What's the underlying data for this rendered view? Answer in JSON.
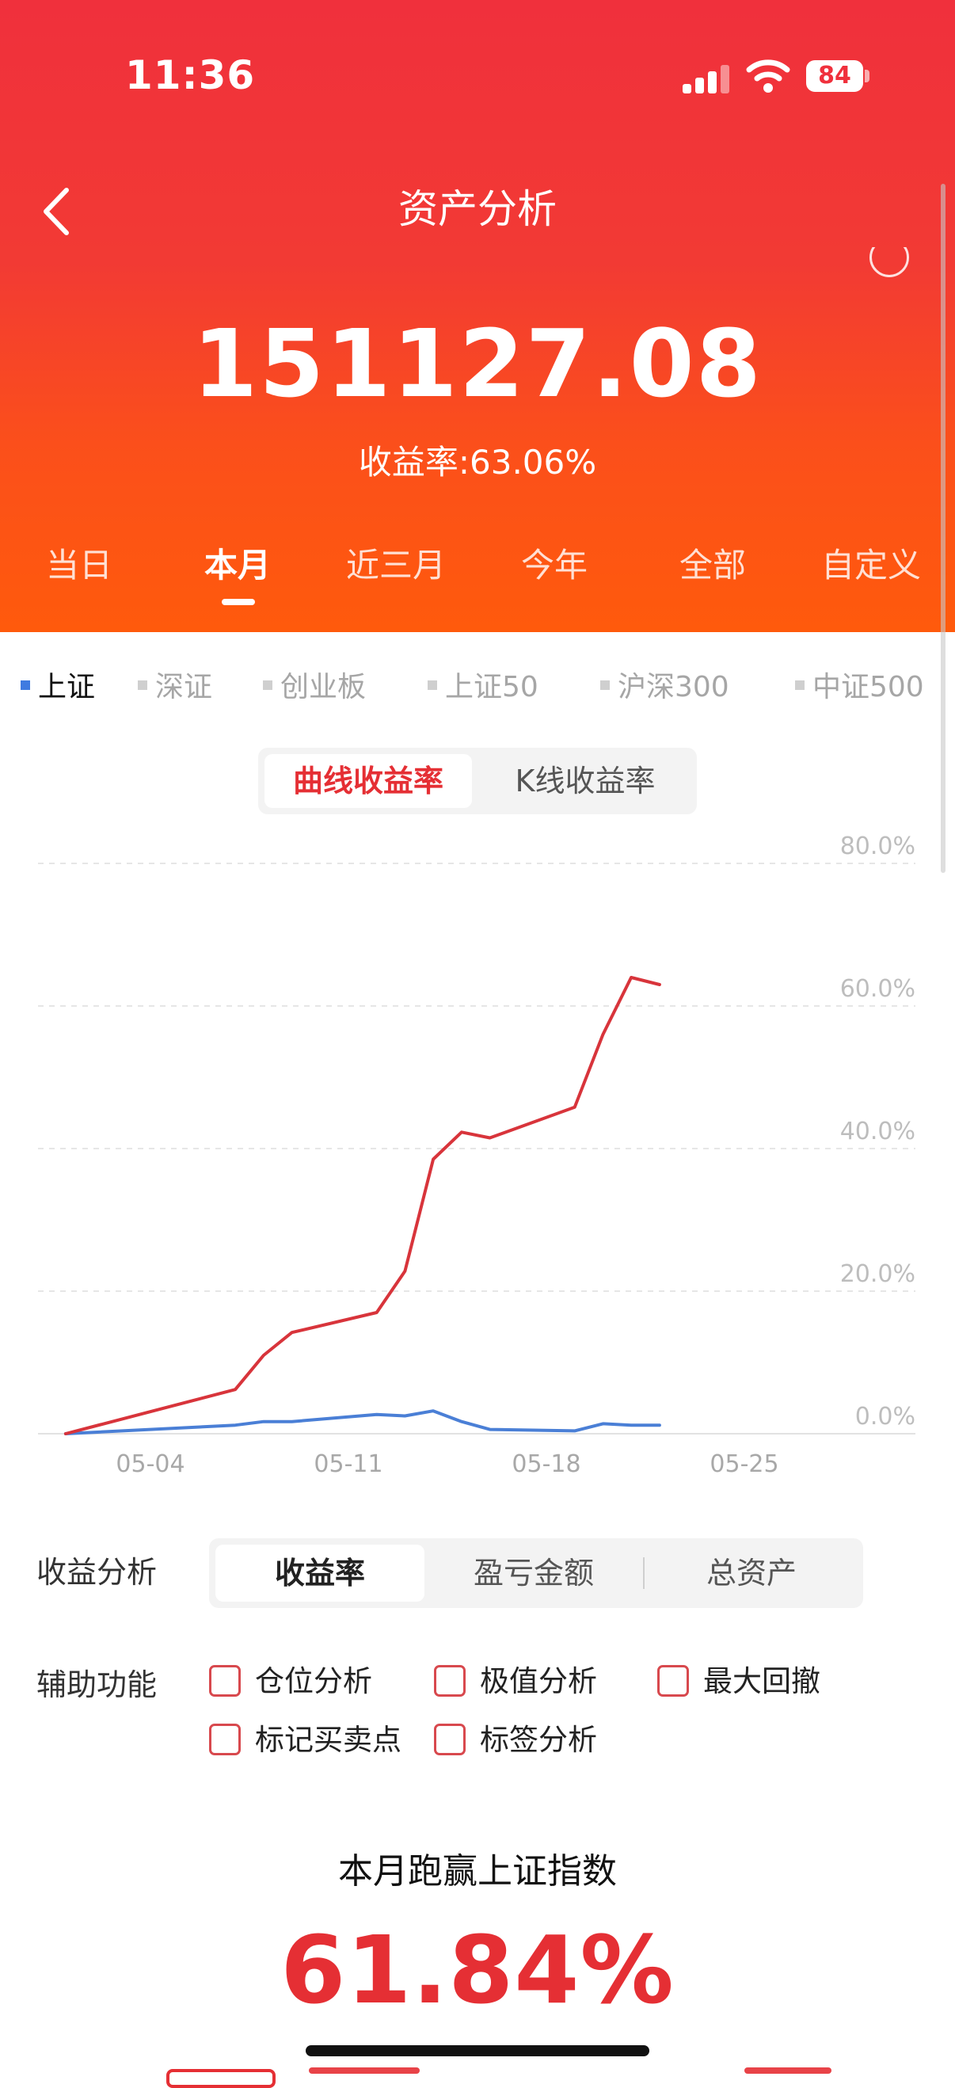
{
  "status_bar": {
    "time": "11:36",
    "battery": "84"
  },
  "nav": {
    "title": "资产分析"
  },
  "summary": {
    "total_assets": "151127.08",
    "return_rate": "收益率:63.06%"
  },
  "period_tabs": [
    {
      "label": "当日",
      "active": false
    },
    {
      "label": "本月",
      "active": true
    },
    {
      "label": "近三月",
      "active": false
    },
    {
      "label": "今年",
      "active": false
    },
    {
      "label": "全部",
      "active": false
    },
    {
      "label": "自定义",
      "active": false
    }
  ],
  "index_tabs": [
    {
      "label": "上证",
      "active": true
    },
    {
      "label": "深证",
      "active": false
    },
    {
      "label": "创业板",
      "active": false
    },
    {
      "label": "上证50",
      "active": false
    },
    {
      "label": "沪深300",
      "active": false
    },
    {
      "label": "中证500",
      "active": false
    }
  ],
  "chart_mode": {
    "options": [
      "曲线收益率",
      "K线收益率"
    ],
    "selected": "曲线收益率"
  },
  "chart_data": {
    "type": "line",
    "ylim": [
      0,
      80
    ],
    "y_ticks": [
      "80.0%",
      "60.0%",
      "40.0%",
      "20.0%",
      "0.0%"
    ],
    "x_ticks": [
      "05-04",
      "05-11",
      "05-18",
      "05-25"
    ],
    "grid": true,
    "colors": {
      "portfolio": "#d8343b",
      "index": "#4a7fd6"
    },
    "series": [
      {
        "key": "portfolio",
        "x": [
          "05-01",
          "05-07",
          "05-08",
          "05-09",
          "05-12",
          "05-13",
          "05-14",
          "05-15",
          "05-16",
          "05-19",
          "05-20",
          "05-21",
          "05-22"
        ],
        "values": [
          0,
          6.2,
          11,
          14.2,
          17,
          22.8,
          38.5,
          42.3,
          41.5,
          45.8,
          56,
          64,
          63
        ]
      },
      {
        "key": "index",
        "x": [
          "05-01",
          "05-07",
          "05-08",
          "05-09",
          "05-12",
          "05-13",
          "05-14",
          "05-15",
          "05-16",
          "05-19",
          "05-20",
          "05-21",
          "05-22"
        ],
        "values": [
          0,
          1.2,
          1.7,
          1.7,
          2.7,
          2.5,
          3.2,
          1.7,
          0.6,
          0.4,
          1.4,
          1.2,
          1.2
        ]
      }
    ]
  },
  "analysis": {
    "label": "收益分析",
    "options": [
      "收益率",
      "盈亏金额",
      "总资产"
    ],
    "selected": "收益率"
  },
  "aux": {
    "label": "辅助功能",
    "options": [
      "仓位分析",
      "极值分析",
      "最大回撤",
      "标记买卖点",
      "标签分析"
    ]
  },
  "beat_index": {
    "title": "本月跑赢上证指数",
    "value": "61.84%"
  }
}
